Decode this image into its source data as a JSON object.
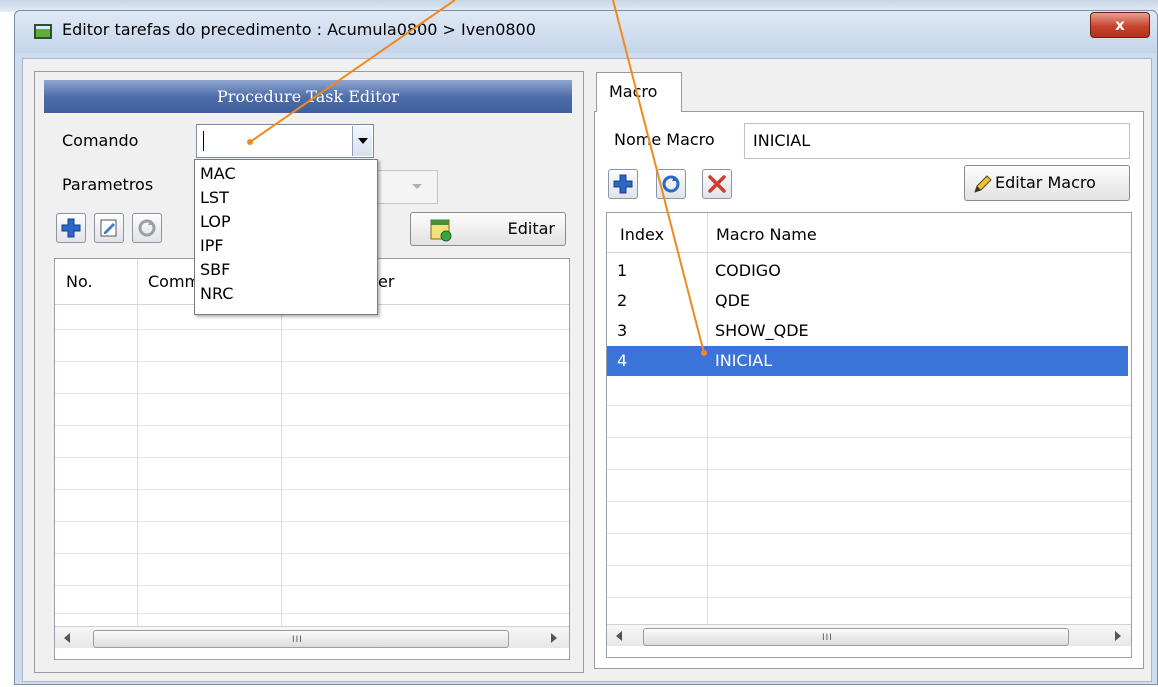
{
  "window": {
    "title": "Editor tarefas do precedimento : Acumula0800 > Iven0800",
    "close_label": "x"
  },
  "left_panel": {
    "header": "Procedure Task Editor",
    "comando_label": "Comando",
    "comando_value": "",
    "parametros_label": "Parametros",
    "editar_label": "Editar",
    "dropdown_options": [
      "MAC",
      "LST",
      "LOP",
      "IPF",
      "SBF",
      "NRC"
    ],
    "table": {
      "columns": [
        "No.",
        "Comm",
        "er"
      ]
    }
  },
  "right_panel": {
    "tab_label": "Macro",
    "nome_macro_label": "Nome Macro",
    "nome_macro_value": "INICIAL",
    "editar_macro_label": "Editar Macro",
    "table": {
      "columns": [
        "Index",
        "Macro Name"
      ],
      "rows": [
        {
          "index": "1",
          "name": "CODIGO"
        },
        {
          "index": "2",
          "name": "QDE"
        },
        {
          "index": "3",
          "name": "SHOW_QDE"
        },
        {
          "index": "4",
          "name": "INICIAL"
        }
      ],
      "selected_index": "4"
    }
  },
  "scrollbar_grip": "III",
  "colors": {
    "header_blue": "#4f6eaa",
    "selection_blue": "#3b74d8",
    "annotation_orange": "#f08a1c",
    "close_red": "#c7442e"
  }
}
